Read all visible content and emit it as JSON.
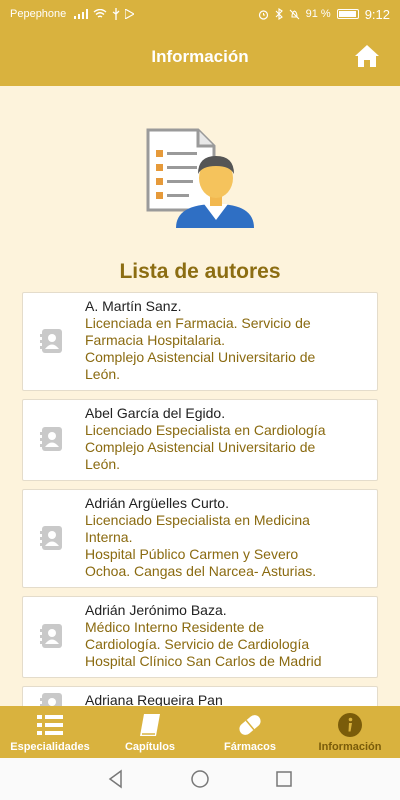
{
  "status_bar": {
    "carrier": "Pepephone",
    "battery": "91 %",
    "time": "9:12"
  },
  "header": {
    "title": "Información",
    "home_icon": "home-icon"
  },
  "main": {
    "list_title": "Lista de autores",
    "authors": [
      {
        "name": "A. Martín Sanz.",
        "details": [
          "Licenciada  en Farmacia. Servicio de",
          "Farmacia Hospitalaria.",
          "Complejo Asistencial Universitario de",
          "León."
        ]
      },
      {
        "name": "Abel García del Egido.",
        "details": [
          "Licenciado Especialista en Cardiología",
          "Complejo Asistencial Universitario de",
          "León."
        ]
      },
      {
        "name": "Adrián Argüelles Curto.",
        "details": [
          "Licenciado Especialista en Medicina",
          "Interna.",
          "Hospital Público Carmen y Severo",
          "Ochoa. Cangas del Narcea- Asturias."
        ]
      },
      {
        "name": "Adrián Jerónimo Baza.",
        "details": [
          "Médico Interno Residente de",
          "Cardiología. Servicio de Cardiología",
          "Hospital Clínico San Carlos de Madrid"
        ]
      },
      {
        "name": "Adriana Regueira Pan",
        "details": []
      }
    ]
  },
  "bottom_nav": {
    "items": [
      {
        "label": "Especialidades",
        "icon": "list-icon"
      },
      {
        "label": "Capítulos",
        "icon": "book-icon"
      },
      {
        "label": "Fármacos",
        "icon": "pill-icon"
      },
      {
        "label": "Información",
        "icon": "info-icon"
      }
    ],
    "active": "Información"
  },
  "colors": {
    "accent": "#d9b23e",
    "background": "#fdf3dc",
    "title_text": "#8c6d12",
    "detail_text": "#8a6a10"
  }
}
